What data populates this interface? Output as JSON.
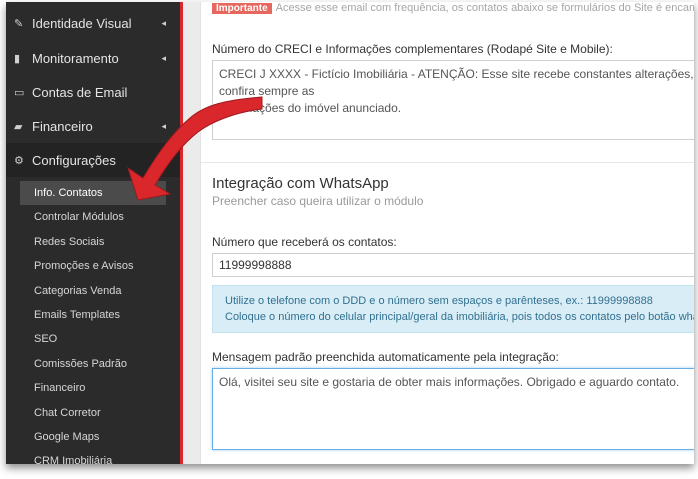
{
  "sidebar": {
    "items": [
      {
        "label": "Identidade Visual",
        "icon": "edit-icon",
        "chevron": "◂"
      },
      {
        "label": "Monitoramento",
        "icon": "bar-chart-icon",
        "chevron": "◂"
      },
      {
        "label": "Contas de Email",
        "icon": "inbox-icon",
        "chevron": ""
      },
      {
        "label": "Financeiro",
        "icon": "book-icon",
        "chevron": "◂"
      },
      {
        "label": "Configurações",
        "icon": "gears-icon",
        "chevron": ""
      }
    ],
    "subitems": [
      "Info. Contatos",
      "Controlar Módulos",
      "Redes Sociais",
      "Promoções e Avisos",
      "Categorias Venda",
      "Emails Templates",
      "SEO",
      "Comissões Padrão",
      "Financeiro",
      "Chat Corretor",
      "Google Maps",
      "CRM Imobiliária"
    ]
  },
  "main": {
    "notice_badge": "Importante",
    "notice_text": "Acesse esse email com frequência, os contatos abaixo se formulários do Site é encaminhados",
    "creci_label": "Número do CRECI e Informações complementares (Rodapé Site e Mobile):",
    "creci_value": "CRECI J XXXX - Fictício Imobiliária - ATENÇÃO: Esse site recebe constantes alterações, confira sempre as\ninformações do imóvel anunciado.",
    "whatsapp_title": "Integração com WhatsApp",
    "whatsapp_subtitle": "Preencher caso queira utilizar o módulo",
    "phone_label": "Número que receberá os contatos:",
    "phone_value": "11999998888",
    "info_line1": "Utilize o telefone com o DDD e o número sem espaços e parênteses, ex.: 11999998888",
    "info_line2": "Coloque o número do celular principal/geral da imobiliária, pois todos os contatos pelo botão whatsapp",
    "message_label": "Mensagem padrão preenchida automaticamente pela integração:",
    "message_value": "Olá, visitei seu site e gostaria de obter mais informações. Obrigado e aguardo contato."
  },
  "colors": {
    "sidebar_bg": "#2b2b2b",
    "accent_red": "#d9272c",
    "info_bg": "#d9edf7",
    "info_text": "#31708f"
  }
}
